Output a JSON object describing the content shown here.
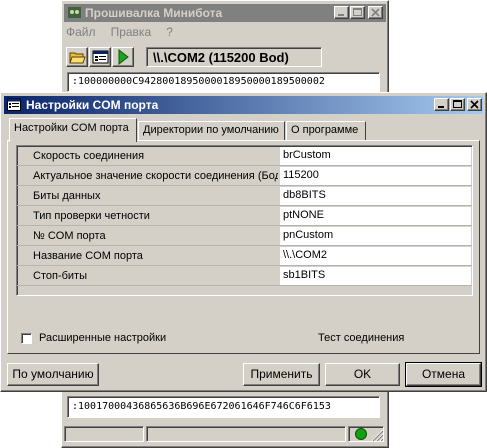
{
  "main_window": {
    "title": "Прошивалка Минибота",
    "menu": [
      "Файл",
      "Правка",
      "?"
    ],
    "port_label": "\\\\.\\COM2 (115200 Bod)",
    "hex_top": ":100000000C9428001895000018950000189500002",
    "hex_bottom": ":10017000436865636B696E672061646F746C6F6153"
  },
  "dialog": {
    "title": "Настройки COM порта",
    "tabs": [
      "Настройки COM порта",
      "Директории по умолчанию",
      "О программе"
    ],
    "settings": [
      {
        "label": "Скорость соединения",
        "value": "brCustom"
      },
      {
        "label": "Актуальное значение скорости соединения (Бод)",
        "value": "115200"
      },
      {
        "label": "Биты данных",
        "value": "db8BITS"
      },
      {
        "label": "Тип проверки четности",
        "value": "ptNONE"
      },
      {
        "label": "№ COM порта",
        "value": "pnCustom"
      },
      {
        "label": "Название COM порта",
        "value": "\\\\.\\COM2"
      },
      {
        "label": "Стоп-биты",
        "value": "sb1BITS"
      }
    ],
    "advanced_label": "Расширенные настройки",
    "test_label": "Тест соединения",
    "buttons": {
      "default": "По умолчанию",
      "apply": "Применить",
      "ok": "OK",
      "cancel": "Отмена"
    }
  },
  "icons": [
    "app-icon",
    "open-folder-icon",
    "settings-icon",
    "run-icon",
    "minimize-icon",
    "maximize-icon",
    "close-icon",
    "status-led-icon",
    "size-grip-icon"
  ]
}
